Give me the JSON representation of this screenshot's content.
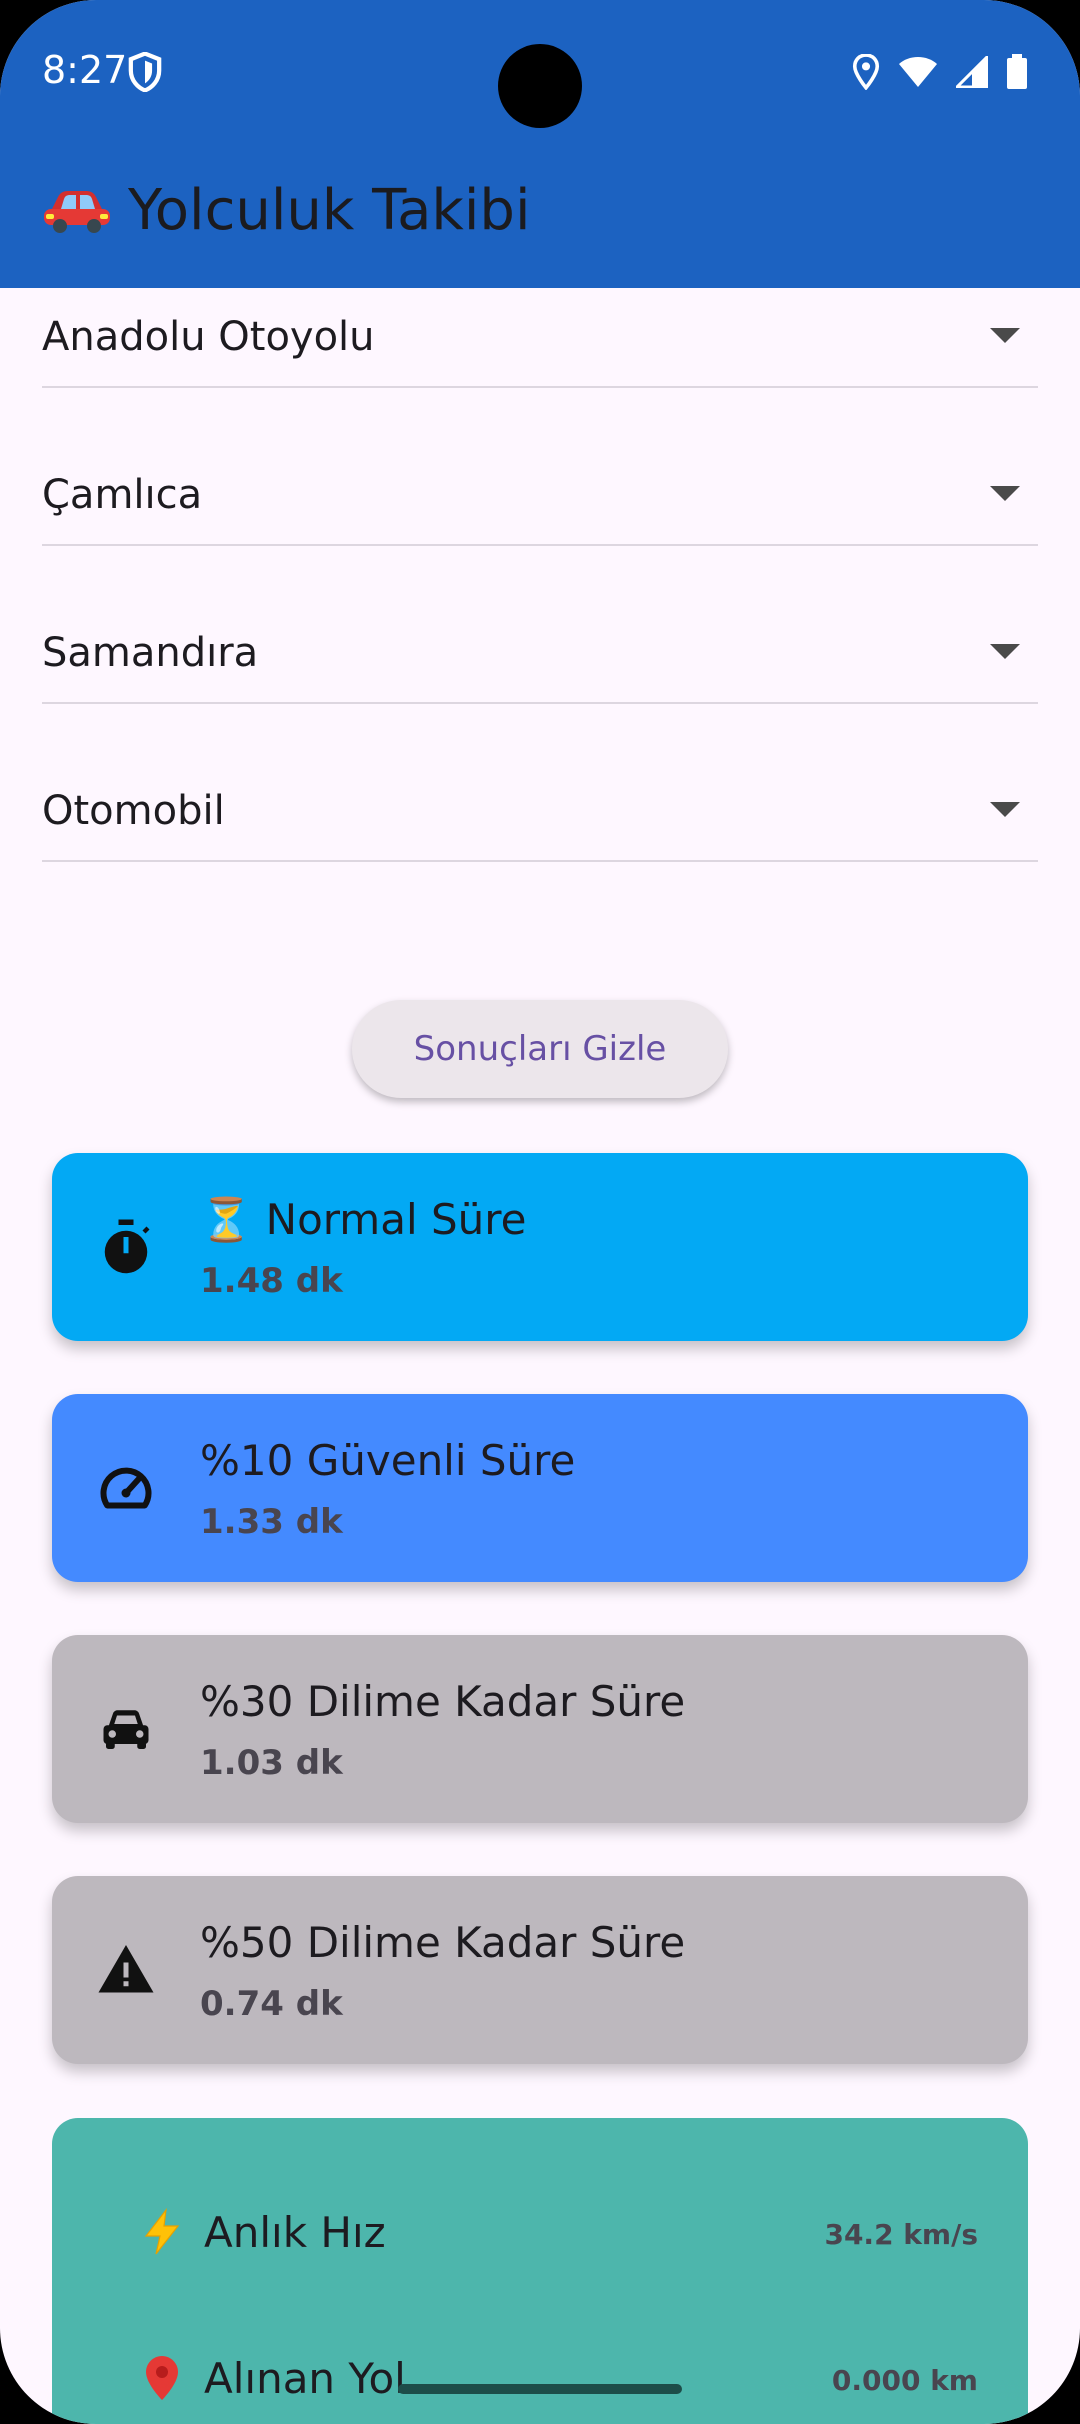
{
  "status_bar": {
    "time": "8:27"
  },
  "app_bar": {
    "icon": "car-icon",
    "title": "Yolculuk Takibi",
    "color": "#1C62C1"
  },
  "dropdowns": [
    {
      "value": "Anadolu Otoyolu"
    },
    {
      "value": "Çamlıca"
    },
    {
      "value": "Samandıra"
    },
    {
      "value": "Otomobil"
    }
  ],
  "toggle_button": {
    "label": "Sonuçları Gizle"
  },
  "result_cards": [
    {
      "icon": "stopwatch-icon",
      "title": "⏳ Normal Süre",
      "value": "1.48 dk",
      "color": "#03A9F4"
    },
    {
      "icon": "speedometer-icon",
      "title": "%10 Güvenli Süre",
      "value": "1.33 dk",
      "color": "#448AFF"
    },
    {
      "icon": "car-icon",
      "title": "%30 Dilime Kadar Süre",
      "value": "1.03 dk",
      "color": "#BDB8BE"
    },
    {
      "icon": "warning-icon",
      "title": "%50 Dilime Kadar Süre",
      "value": "0.74 dk",
      "color": "#BDB8BE"
    }
  ],
  "live_stats": {
    "color": "#4DB6AC",
    "rows": [
      {
        "icon": "lightning-icon",
        "label": "Anlık Hız",
        "value": "34.2 km/s"
      },
      {
        "icon": "pin-icon",
        "label": "Alınan Yol",
        "value": "0.000 km"
      }
    ]
  }
}
